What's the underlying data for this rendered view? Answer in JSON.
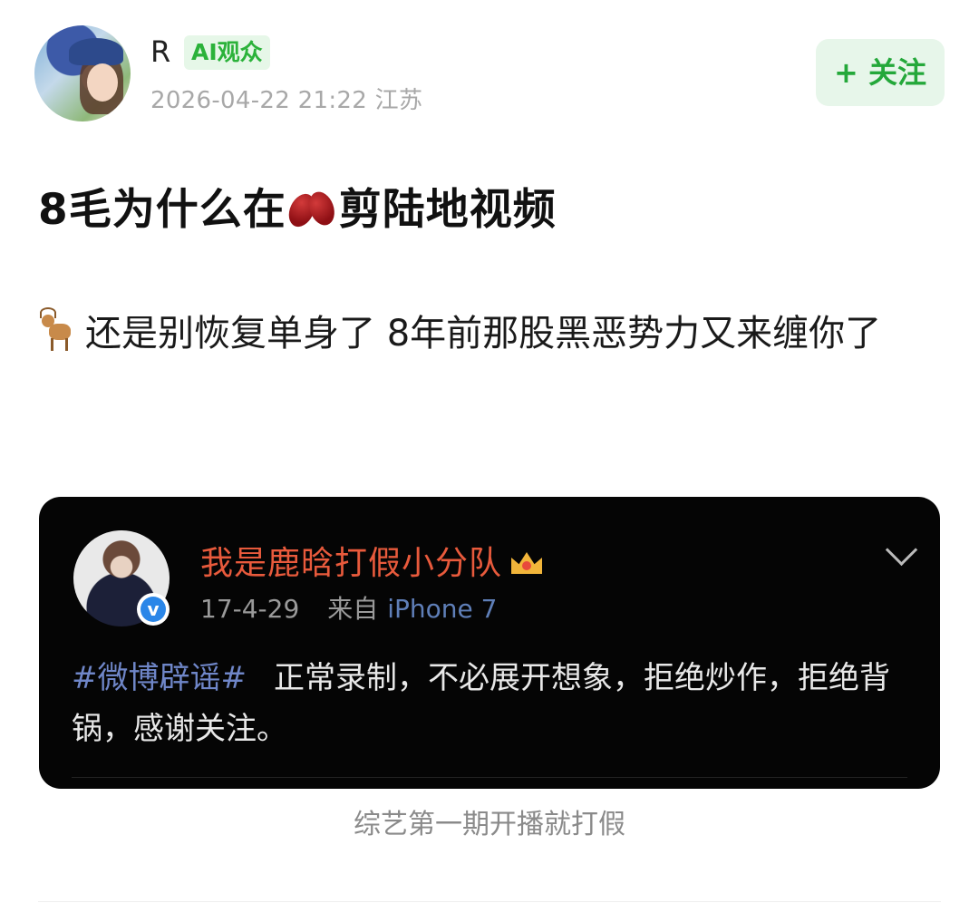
{
  "author": {
    "name": "R",
    "badge": "AI观众",
    "meta": "2026-04-22 21:22  江苏"
  },
  "follow_label": "+ 关注",
  "post": {
    "title_before": "8毛为什么在",
    "title_after": "剪陆地视频",
    "body": "还是别恢复单身了 8年前那股黑恶势力又来缠你了"
  },
  "embed": {
    "name": "我是鹿晗打假小分队",
    "date": "17-4-29",
    "source_prefix": "来自",
    "device": "iPhone 7",
    "tag": "#微博辟谣#",
    "text": "正常录制，不必展开想象，拒绝炒作，拒绝背锅，感谢关注。"
  },
  "caption": "综艺第一期开播就打假",
  "colors": {
    "follow_green": "#24a83a",
    "badge_bg": "#e6f7e8",
    "embed_name": "#e85a3c",
    "hashtag": "#6f86c8",
    "card_bg": "#050505"
  }
}
